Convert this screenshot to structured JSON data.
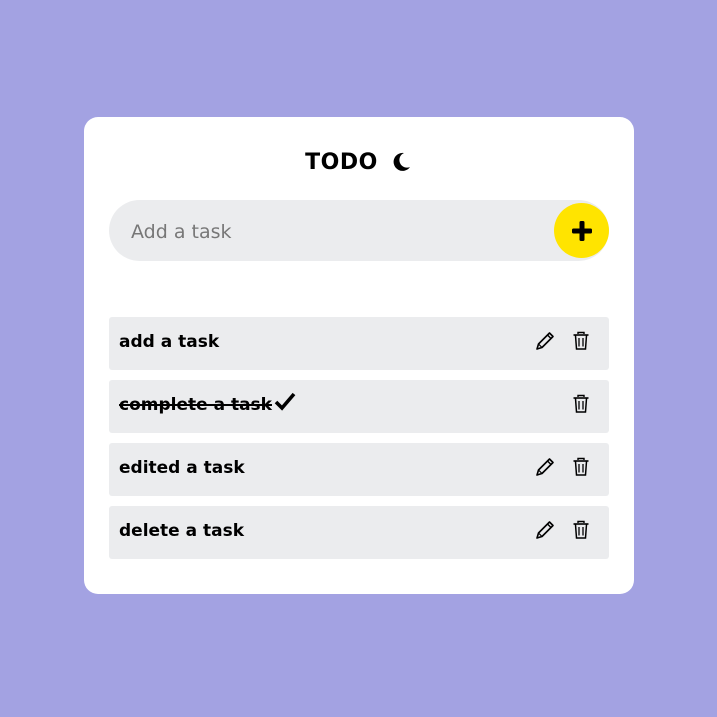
{
  "app": {
    "title": "TODO",
    "theme_icon": "moon-icon"
  },
  "input": {
    "placeholder": "Add a task",
    "value": "",
    "add_button_icon": "plus-icon"
  },
  "tasks": [
    {
      "label": "add a task",
      "completed": false,
      "editable": true
    },
    {
      "label": "complete a task",
      "completed": true,
      "editable": false
    },
    {
      "label": "edited a task",
      "completed": false,
      "editable": true
    },
    {
      "label": "delete a task",
      "completed": false,
      "editable": true
    }
  ],
  "icons": {
    "edit": "pencil-icon",
    "delete": "trash-icon",
    "done": "check-icon"
  },
  "colors": {
    "background": "#a3a2e2",
    "card": "#ffffff",
    "row": "#ebecee",
    "accent": "#ffe400"
  }
}
